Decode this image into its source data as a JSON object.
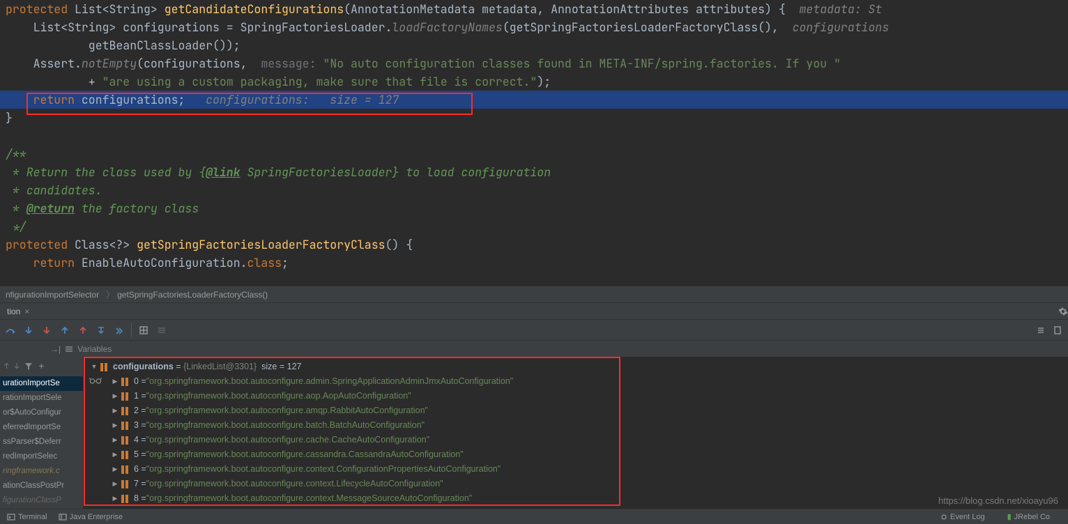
{
  "code": {
    "l0": "protected",
    "l0b": " List<String> ",
    "l0c": "getCandidateConfigurations",
    "l0d": "(AnnotationMetadata metadata, AnnotationAttributes attributes) {  ",
    "l0e": "metadata: St",
    "l1a": "    List<String> configurations = SpringFactoriesLoader.",
    "l1b": "loadFactoryNames",
    "l1c": "(getSpringFactoriesLoaderFactoryClass(),  ",
    "l1d": "configurations",
    "l2a": "            getBeanClassLoader());",
    "l3a": "    Assert.",
    "l3b": "notEmpty",
    "l3c": "(configurations,  ",
    "l3d": "message: ",
    "l3e": "\"No auto configuration classes found in META-INF/spring.factories. If you \"",
    "l4a": "            + ",
    "l4b": "\"are using a custom packaging, make sure that file is correct.\"",
    "l4c": ");",
    "l5a": "    return",
    "l5b": " configurations;   ",
    "l5c": "configurations:   size = 127",
    "l6": "}",
    "l7": "",
    "d1": "/**",
    "d2": " * Return the class used by {",
    "d2b": "@link",
    "d2c": " SpringFactoriesLoader} to load configuration",
    "d3": " * candidates.",
    "d4": " * ",
    "d4b": "@return",
    "d4c": " the factory class",
    "d5": " */",
    "m1a": "protected",
    "m1b": " Class<?> ",
    "m1c": "getSpringFactoriesLoaderFactoryClass",
    "m1d": "() {",
    "m2a": "    return",
    "m2b": " EnableAutoConfiguration.",
    "m2c": "class",
    "m2d": ";"
  },
  "breadcrumbs": {
    "a": "nfigurationImportSelector",
    "b": "getSpringFactoriesLoaderFactoryClass()"
  },
  "tab": {
    "name": "tion"
  },
  "varlabel": "Variables",
  "frames": [
    "urationImportSe",
    "rationImportSele",
    "or$AutoConfigur",
    "eferredImportSe",
    "ssParser$Deferr",
    "redImportSelec",
    "ringframework.c",
    "ationClassPostPr",
    "figurationClassP"
  ],
  "tree": {
    "root": {
      "name": "configurations",
      "type": "{LinkedList@3301}",
      "size": "size = 127"
    },
    "items": [
      {
        "idx": "0",
        "val": "\"org.springframework.boot.autoconfigure.admin.SpringApplicationAdminJmxAutoConfiguration\""
      },
      {
        "idx": "1",
        "val": "\"org.springframework.boot.autoconfigure.aop.AopAutoConfiguration\""
      },
      {
        "idx": "2",
        "val": "\"org.springframework.boot.autoconfigure.amqp.RabbitAutoConfiguration\""
      },
      {
        "idx": "3",
        "val": "\"org.springframework.boot.autoconfigure.batch.BatchAutoConfiguration\""
      },
      {
        "idx": "4",
        "val": "\"org.springframework.boot.autoconfigure.cache.CacheAutoConfiguration\""
      },
      {
        "idx": "5",
        "val": "\"org.springframework.boot.autoconfigure.cassandra.CassandraAutoConfiguration\""
      },
      {
        "idx": "6",
        "val": "\"org.springframework.boot.autoconfigure.context.ConfigurationPropertiesAutoConfiguration\""
      },
      {
        "idx": "7",
        "val": "\"org.springframework.boot.autoconfigure.context.LifecycleAutoConfiguration\""
      },
      {
        "idx": "8",
        "val": "\"org.springframework.boot.autoconfigure.context.MessageSourceAutoConfiguration\""
      }
    ]
  },
  "status": {
    "terminal": "Terminal",
    "java": "Java Enterprise",
    "event": "Event Log",
    "jrebel": "JRebel Co"
  },
  "watermark": "https://blog.csdn.net/xioayu96"
}
